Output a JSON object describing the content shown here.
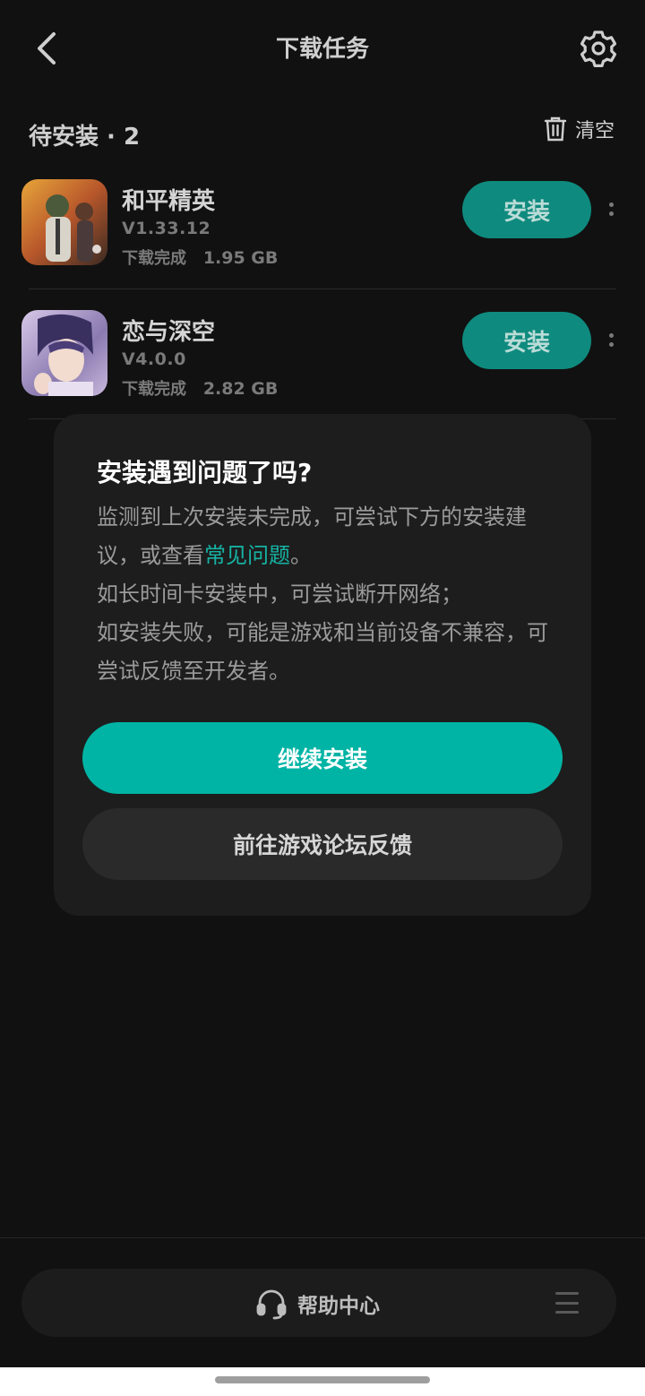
{
  "header": {
    "title": "下载任务"
  },
  "section": {
    "title": "待安装 · 2",
    "clear_label": "清空"
  },
  "games": [
    {
      "name": "和平精英",
      "version": "V1.33.12",
      "status": "下载完成",
      "size": "1.95 GB",
      "button": "安装",
      "icon": "pubg-game-icon"
    },
    {
      "name": "恋与深空",
      "version": "V4.0.0",
      "status": "下载完成",
      "size": "2.82 GB",
      "button": "安装",
      "icon": "love-deepspace-game-icon"
    }
  ],
  "dialog": {
    "title": "安装遇到问题了吗?",
    "body_line1": "监测到上次安装未完成，可尝试下方的安装建议，或查看",
    "link": "常见问题",
    "body_line1_end": "。",
    "body_line2": "如长时间卡安装中，可尝试断开网络；",
    "body_line3": "如安装失败，可能是游戏和当前设备不兼容，可尝试反馈至开发者。",
    "primary_button": "继续安装",
    "secondary_button": "前往游戏论坛反馈"
  },
  "bottom": {
    "help_label": "帮助中心"
  },
  "colors": {
    "background": "#111111",
    "accent": "#00b4a5",
    "install_button": "#0f8a7e",
    "dialog_bg": "#1d1d1d"
  }
}
